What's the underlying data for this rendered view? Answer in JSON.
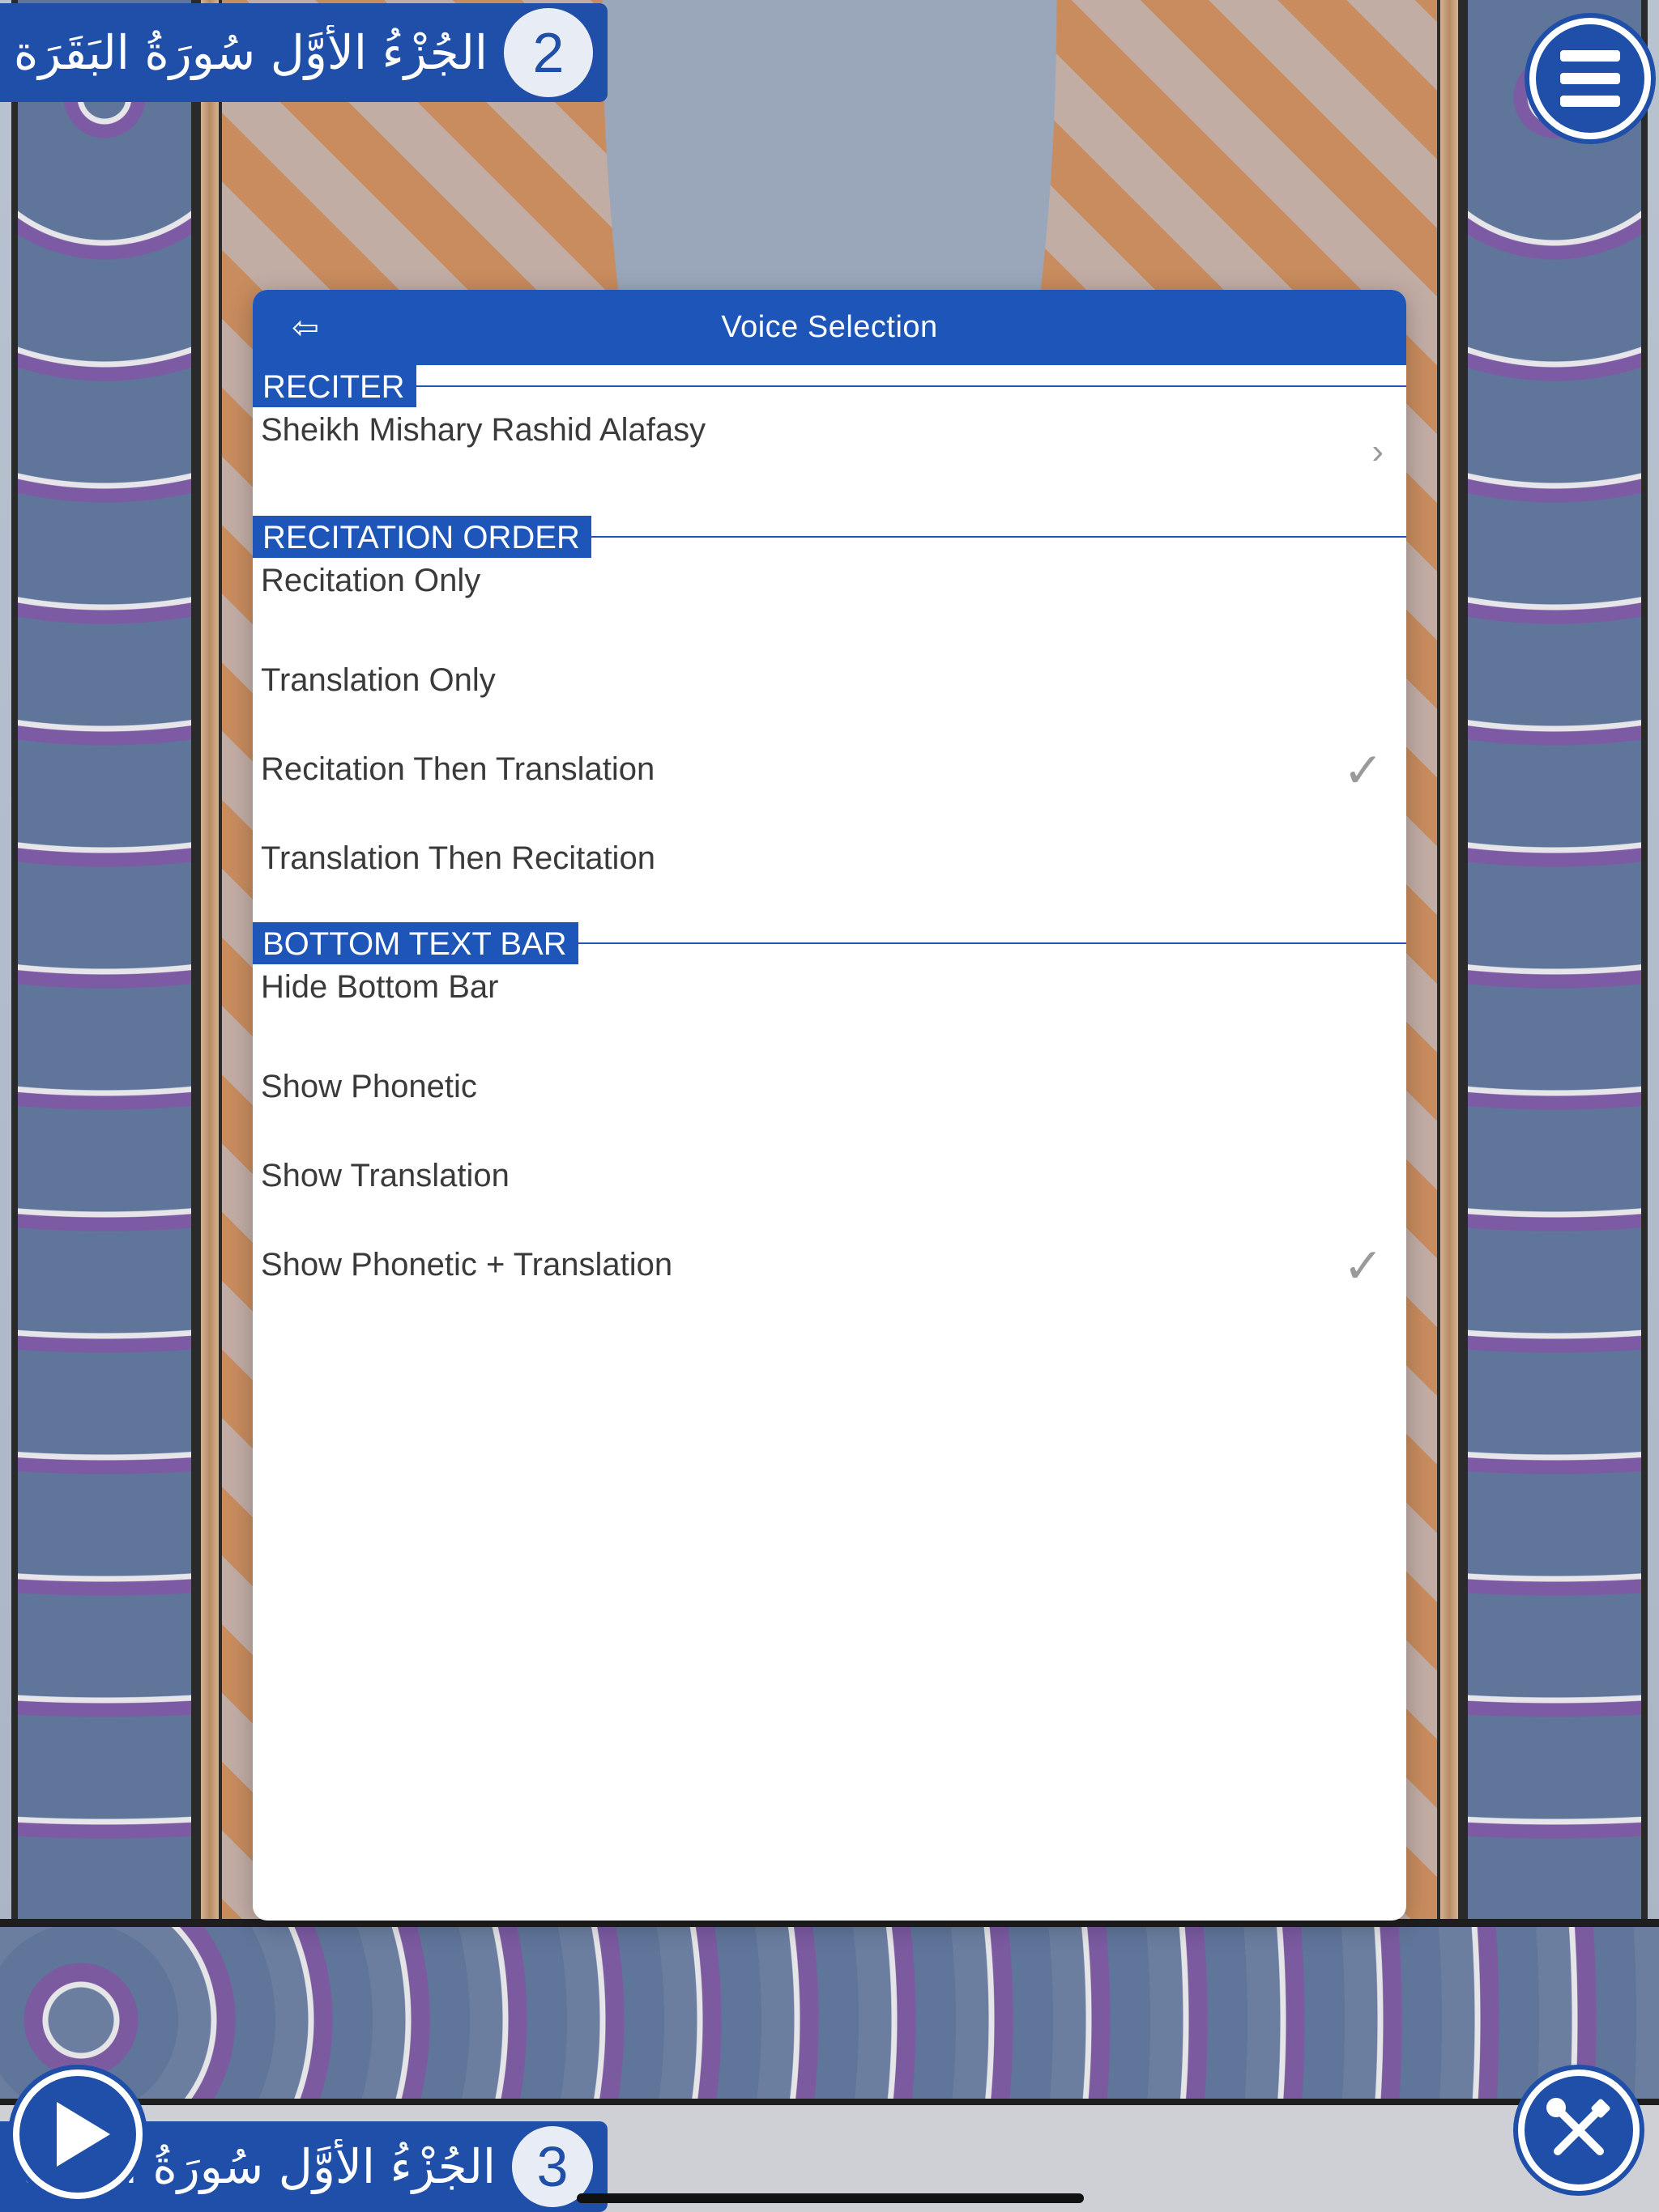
{
  "header": {
    "top_juz_label": "الجُزْءُ الأَوَّل سُورَةُ البَقَرَة",
    "top_page_number": "2",
    "bottom_juz_label": "الجُزْءُ الأَوَّل سُورَةُ البَقَرَة",
    "bottom_page_number": "3"
  },
  "panel": {
    "title": "Voice Selection",
    "back_glyph": "⇦",
    "sections": {
      "reciter": {
        "header": "RECITER",
        "items": [
          {
            "label": "Sheikh Mishary Rashid Alafasy",
            "accessory": "›"
          }
        ]
      },
      "recitation_order": {
        "header": "RECITATION ORDER",
        "items": [
          {
            "label": "Recitation Only",
            "checked": false
          },
          {
            "label": "Translation Only",
            "checked": false
          },
          {
            "label": "Recitation Then Translation",
            "checked": true
          },
          {
            "label": "Translation Then Recitation",
            "checked": false
          }
        ]
      },
      "bottom_text_bar": {
        "header": "BOTTOM TEXT BAR",
        "items": [
          {
            "label": "Hide Bottom Bar",
            "checked": false
          },
          {
            "label": "Show Phonetic",
            "checked": false
          },
          {
            "label": "Show Translation",
            "checked": false
          },
          {
            "label": "Show Phonetic + Translation",
            "checked": true
          }
        ]
      }
    },
    "check_glyph": "✓"
  },
  "icons": {
    "menu": "hamburger-icon",
    "play": "play-icon",
    "tools": "tools-icon",
    "back": "back-arrow-icon",
    "check": "checkmark-icon",
    "chevron": "chevron-right-icon"
  },
  "colors": {
    "accent": "#1d56b8",
    "pill": "#1f4fa8",
    "text": "#3a3a3a",
    "check": "#9a9a9a"
  }
}
